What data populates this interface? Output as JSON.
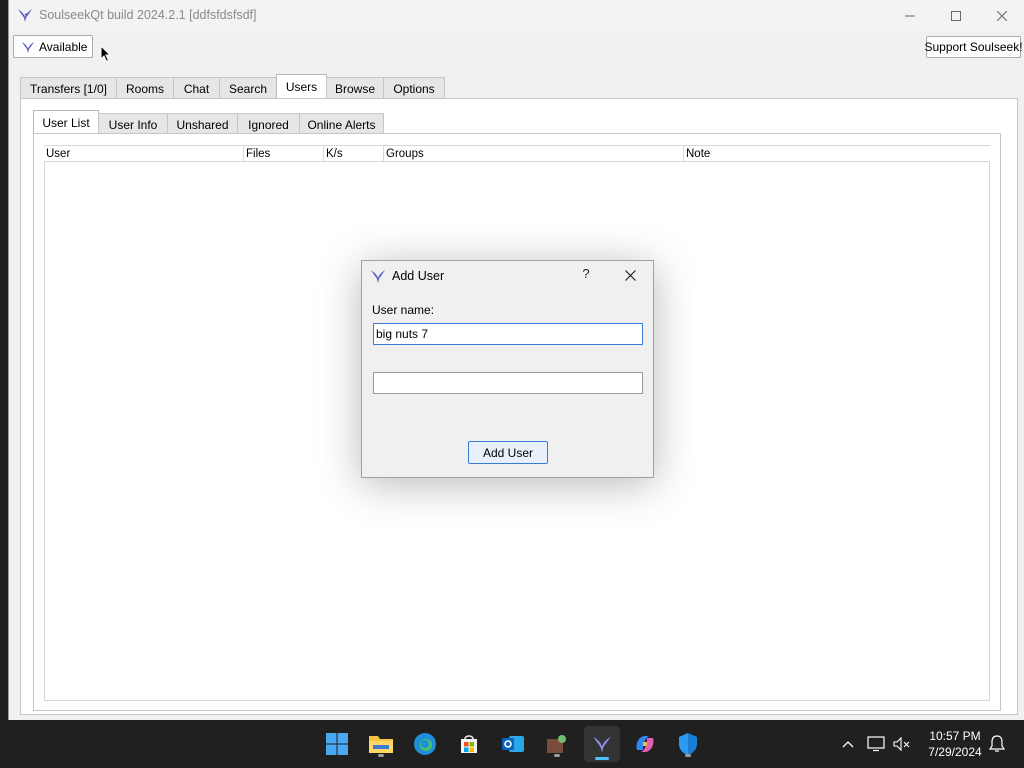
{
  "window": {
    "title": "SoulseekQt build 2024.2.1 [ddfsfdsfsdf]"
  },
  "toolbar": {
    "status_label": "Available",
    "support_label": "Support Soulseek!"
  },
  "main_tabs": [
    {
      "label": "Transfers [1/0]",
      "active": false
    },
    {
      "label": "Rooms",
      "active": false
    },
    {
      "label": "Chat",
      "active": false
    },
    {
      "label": "Search",
      "active": false
    },
    {
      "label": "Users",
      "active": true
    },
    {
      "label": "Browse",
      "active": false
    },
    {
      "label": "Options",
      "active": false
    }
  ],
  "sub_tabs": [
    {
      "label": "User List",
      "active": true
    },
    {
      "label": "User Info",
      "active": false
    },
    {
      "label": "Unshared",
      "active": false
    },
    {
      "label": "Ignored",
      "active": false
    },
    {
      "label": "Online Alerts",
      "active": false
    }
  ],
  "table": {
    "columns": [
      "User",
      "Files",
      "K/s",
      "Groups",
      "Note"
    ]
  },
  "dialog": {
    "title": "Add User",
    "help_label": "?",
    "user_name_label": "User name:",
    "user_name_value": "big nuts 7",
    "second_field_value": "",
    "add_button_label": "Add User"
  },
  "taskbar": {
    "time": "10:57 PM",
    "date": "7/29/2024",
    "icons": [
      "windows-start-icon",
      "file-explorer-icon",
      "edge-browser-icon",
      "microsoft-store-icon",
      "outlook-icon",
      "app-icon",
      "soulseek-icon",
      "copilot-icon",
      "defender-icon"
    ]
  },
  "colors": {
    "accent": "#3a7bd5",
    "taskbar_bg": "#202020",
    "window_bg": "#f0f0f0"
  }
}
